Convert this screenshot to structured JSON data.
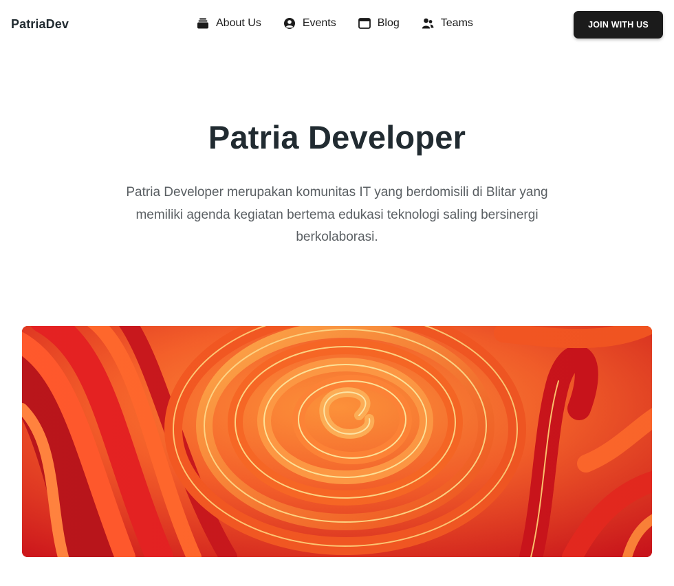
{
  "header": {
    "brand": "PatriaDev",
    "nav": [
      {
        "label": "About Us",
        "icon": "layers-icon"
      },
      {
        "label": "Events",
        "icon": "user-circle-icon"
      },
      {
        "label": "Blog",
        "icon": "browser-window-icon"
      },
      {
        "label": "Teams",
        "icon": "users-icon"
      }
    ],
    "cta_label": "JOIN WITH US"
  },
  "hero": {
    "title": "Patria Developer",
    "description": "Patria Developer merupakan komunitas IT yang berdomisili di Blitar yang memiliki agenda kegiatan bertema edukasi teknologi saling bersinergi berkolaborasi.",
    "image": "abstract-orange-spiral-paper-image"
  },
  "colors": {
    "text": "#212b31",
    "muted": "#5a5f63",
    "button_bg": "#1b1b1b",
    "accent_orange": "#f5792a",
    "accent_red": "#d4161c"
  }
}
